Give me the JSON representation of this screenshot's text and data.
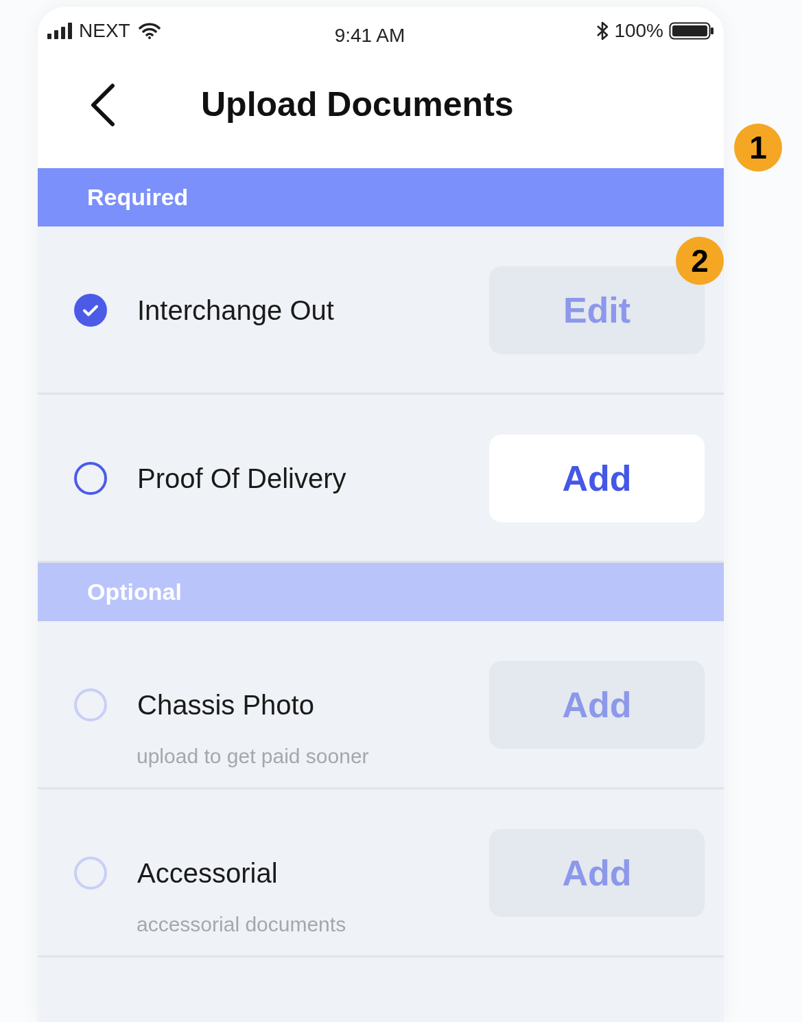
{
  "status_bar": {
    "carrier": "NEXT",
    "time": "9:41 AM",
    "battery": "100%"
  },
  "header": {
    "title": "Upload Documents"
  },
  "sections": [
    {
      "kind": "required",
      "label": "Required",
      "items": [
        {
          "label": "Interchange Out",
          "checked": true,
          "button": {
            "label": "Edit",
            "disabled": true
          }
        },
        {
          "label": "Proof Of Delivery",
          "checked": false,
          "button": {
            "label": "Add",
            "disabled": false
          }
        }
      ]
    },
    {
      "kind": "optional",
      "label": "Optional",
      "items": [
        {
          "label": "Chassis Photo",
          "subtitle": "upload to get paid sooner",
          "checked": false,
          "button": {
            "label": "Add",
            "disabled": true
          }
        },
        {
          "label": "Accessorial",
          "subtitle": "accessorial documents",
          "checked": false,
          "button": {
            "label": "Add",
            "disabled": true
          }
        }
      ]
    }
  ],
  "annotations": [
    "1",
    "2"
  ]
}
